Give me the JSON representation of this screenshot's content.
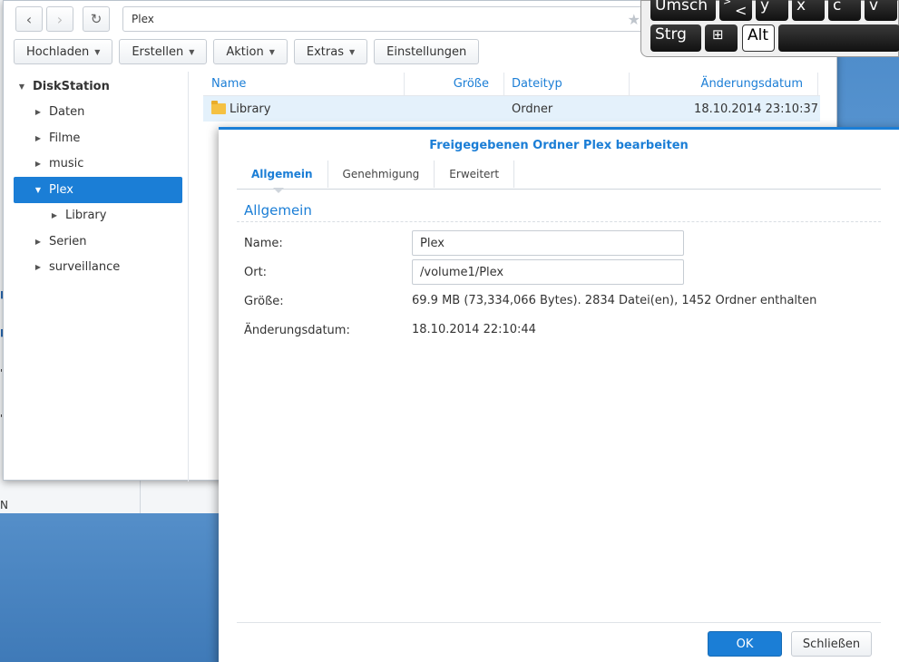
{
  "background": {
    "status_letter": "N"
  },
  "file_station": {
    "path": "Plex",
    "actions": [
      {
        "label": "Hochladen",
        "has_menu": true
      },
      {
        "label": "Erstellen",
        "has_menu": true
      },
      {
        "label": "Aktion",
        "has_menu": true
      },
      {
        "label": "Extras",
        "has_menu": true
      },
      {
        "label": "Einstellungen",
        "has_menu": false
      }
    ],
    "tree": {
      "root": "DiskStation",
      "items": [
        "Daten",
        "Filme",
        "music",
        "Plex",
        "Library",
        "Serien",
        "surveillance"
      ],
      "selected": "Plex"
    },
    "list": {
      "columns": [
        "Name",
        "Größe",
        "Dateityp",
        "Änderungsdatum"
      ],
      "rows": [
        {
          "name": "Library",
          "size": "",
          "type": "Ordner",
          "modified": "18.10.2014 23:10:37"
        }
      ]
    }
  },
  "keyboard": {
    "row1": [
      "Umsch",
      "<",
      "y",
      "x",
      "c",
      "v"
    ],
    "row1_shift_hint": ">",
    "row2": [
      "Strg",
      "Alt"
    ]
  },
  "dialog": {
    "title": "Freigegebenen Ordner Plex bearbeiten",
    "tabs": [
      "Allgemein",
      "Genehmigung",
      "Erweitert"
    ],
    "active_tab": "Allgemein",
    "section_title": "Allgemein",
    "fields": {
      "name_label": "Name:",
      "name_value": "Plex",
      "location_label": "Ort:",
      "location_value": "/volume1/Plex",
      "size_label": "Größe:",
      "size_value": "69.9 MB (73,334,066 Bytes). 2834 Datei(en), 1452 Ordner enthalten",
      "modified_label": "Änderungsdatum:",
      "modified_value": "18.10.2014 22:10:44"
    },
    "ok_label": "OK",
    "close_label": "Schließen"
  },
  "colors": {
    "accent": "#1b7ed6",
    "selection_bg": "#e4f1fb",
    "folder": "#f5c142"
  }
}
